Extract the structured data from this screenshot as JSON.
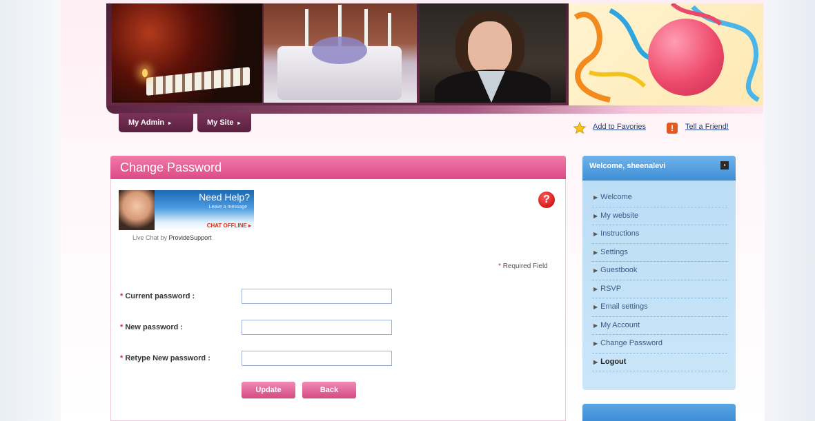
{
  "nav": {
    "tabs": [
      {
        "label": "My Admin"
      },
      {
        "label": "My Site"
      }
    ],
    "arrow": "▸"
  },
  "toplinks": {
    "favorites": "Add to Favories",
    "tell_friend": "Tell a Friend!"
  },
  "panel": {
    "title": "Change Password",
    "help": {
      "title": "Need Help?",
      "sub": "Leave a message",
      "status": "CHAT OFFLINE ▸",
      "credit_prefix": "Live Chat by",
      "credit_brand": "ProvideSupport"
    },
    "required_star": "*",
    "required_note": "Required Field",
    "fields": [
      {
        "label": "Current password :",
        "value": ""
      },
      {
        "label": "New password :",
        "value": ""
      },
      {
        "label": "Retype New password :",
        "value": ""
      }
    ],
    "buttons": {
      "update": "Update",
      "back": "Back"
    }
  },
  "sidebar": {
    "welcome": "Welcome, sheenalevi",
    "items": [
      {
        "label": "Welcome"
      },
      {
        "label": "My website"
      },
      {
        "label": "Instructions"
      },
      {
        "label": "Settings"
      },
      {
        "label": "Guestbook"
      },
      {
        "label": "RSVP"
      },
      {
        "label": "Email settings"
      },
      {
        "label": "My Account"
      },
      {
        "label": "Change Password"
      },
      {
        "label": "Logout"
      }
    ]
  },
  "colors": {
    "brand_pink": "#dc4b86",
    "nav_plum": "#5a2040",
    "sidebar_blue": "#3f8fd6",
    "link_blue": "#1e3f8a"
  },
  "icons": {
    "help": "question-icon",
    "favorites": "star-icon",
    "tell_friend": "alert-icon",
    "close": "close-icon"
  }
}
